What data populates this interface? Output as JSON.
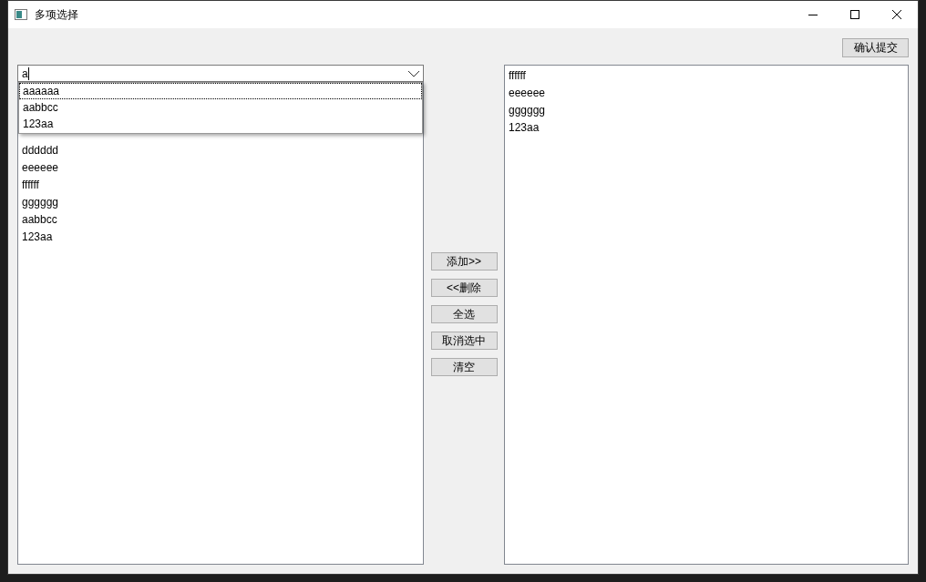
{
  "window": {
    "title": "多项选择"
  },
  "confirm_button": "确认提交",
  "search": {
    "value": "a"
  },
  "completion_popup": {
    "items": [
      {
        "label": "aaaaaa",
        "focused": true
      },
      {
        "label": "aabbcc",
        "focused": false
      },
      {
        "label": "123aa",
        "focused": false
      }
    ]
  },
  "source_list": {
    "items": [
      "dddddd",
      "eeeeee",
      "ffffff",
      "gggggg",
      "aabbcc",
      "123aa"
    ]
  },
  "action_buttons": [
    "添加>>",
    "<<删除",
    "全选",
    "取消选中",
    "清空"
  ],
  "selected_list": {
    "items": [
      "ffffff",
      "eeeeee",
      "gggggg",
      "123aa"
    ]
  }
}
